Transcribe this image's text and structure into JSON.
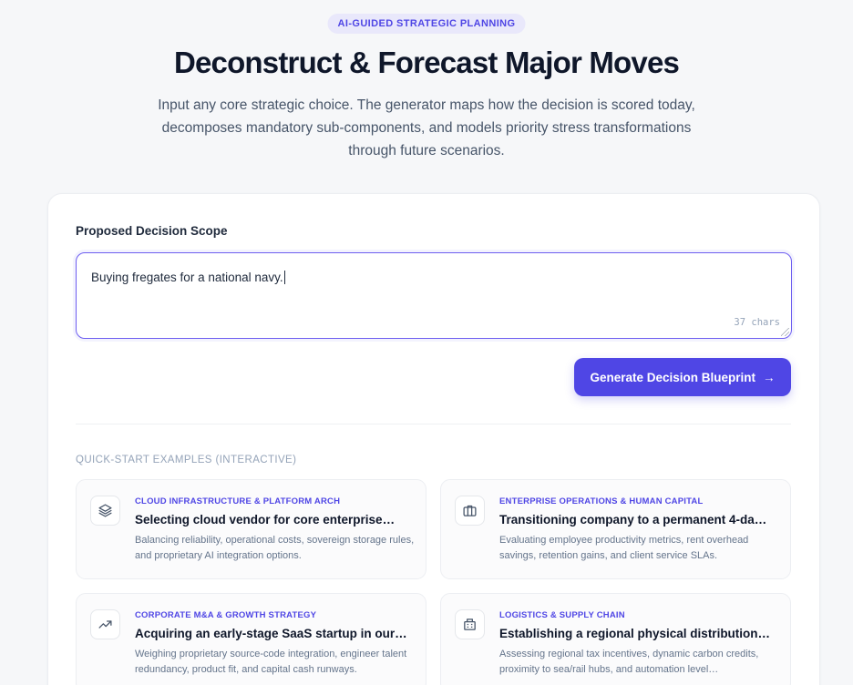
{
  "header": {
    "badge": "AI-GUIDED STRATEGIC PLANNING",
    "title": "Deconstruct & Forecast Major Moves",
    "subtitle": "Input any core strategic choice. The generator maps how the decision is scored today, decomposes mandatory sub-components, and models priority stress transformations through future scenarios."
  },
  "form": {
    "label": "Proposed Decision Scope",
    "value": "Buying fregates for a national navy.",
    "char_count": "37 chars",
    "generate_label": "Generate Decision Blueprint",
    "generate_arrow": "→"
  },
  "examples": {
    "heading": "QUICK-START EXAMPLES (INTERACTIVE)",
    "items": [
      {
        "icon": "layers-icon",
        "category": "CLOUD INFRASTRUCTURE & PLATFORM ARCH",
        "title": "Selecting cloud vendor for core enterprise…",
        "description": "Balancing reliability, operational costs, sovereign storage rules, and proprietary AI integration options."
      },
      {
        "icon": "briefcase-icon",
        "category": "ENTERPRISE OPERATIONS & HUMAN CAPITAL",
        "title": "Transitioning company to a permanent 4-day…",
        "description": "Evaluating employee productivity metrics, rent overhead savings, retention gains, and client service SLAs."
      },
      {
        "icon": "trending-up-icon",
        "category": "CORPORATE M&A & GROWTH STRATEGY",
        "title": "Acquiring an early-stage SaaS startup in our…",
        "description": "Weighing proprietary source-code integration, engineer talent redundancy, product fit, and capital cash runways."
      },
      {
        "icon": "building-icon",
        "category": "LOGISTICS & SUPPLY CHAIN",
        "title": "Establishing a regional physical distribution…",
        "description": "Assessing regional tax incentives, dynamic carbon credits, proximity to sea/rail hubs, and automation level…"
      }
    ]
  },
  "colors": {
    "accent": "#4f46e5",
    "background": "#f6f7f9",
    "card": "#ffffff"
  }
}
